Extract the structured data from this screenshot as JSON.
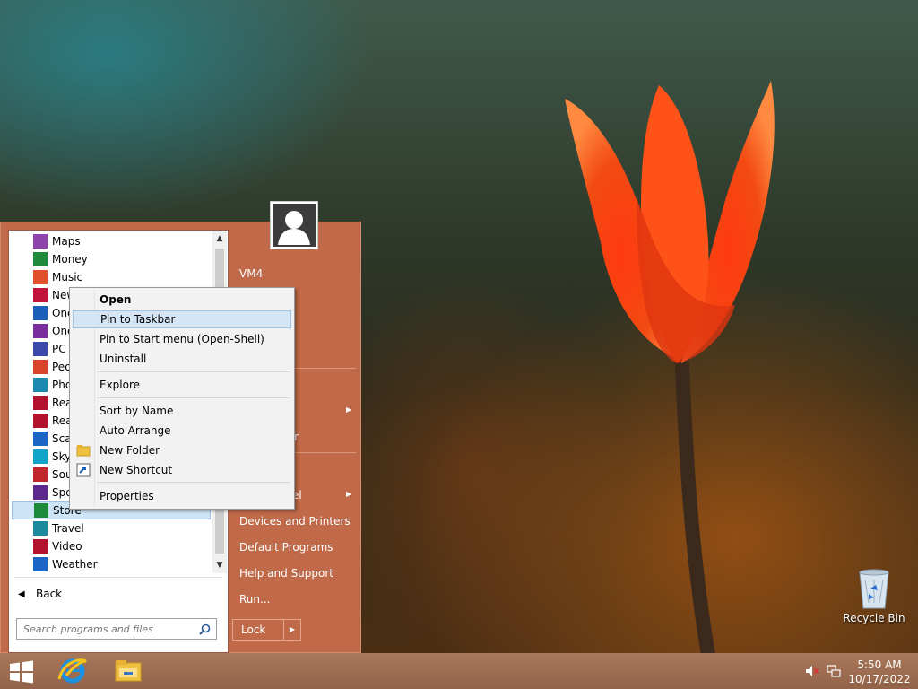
{
  "programs": [
    {
      "label": "Maps",
      "icon": "maps-icon",
      "color": "#8e44ad"
    },
    {
      "label": "Money",
      "icon": "money-icon",
      "color": "#1f8a3b"
    },
    {
      "label": "Music",
      "icon": "music-icon",
      "color": "#e0502a"
    },
    {
      "label": "New",
      "icon": "news-icon",
      "color": "#c0143c"
    },
    {
      "label": "One",
      "icon": "onedrive-icon",
      "color": "#1b5fb8"
    },
    {
      "label": "One",
      "icon": "onenote-icon",
      "color": "#7a2d9c"
    },
    {
      "label": "PC",
      "icon": "pc-settings-icon",
      "color": "#3b4aa8"
    },
    {
      "label": "Peo",
      "icon": "people-icon",
      "color": "#d8452b"
    },
    {
      "label": "Pho",
      "icon": "photos-icon",
      "color": "#1a8ab0"
    },
    {
      "label": "Rea",
      "icon": "reader-icon",
      "color": "#b3122f"
    },
    {
      "label": "Rea",
      "icon": "reading-list-icon",
      "color": "#b3122f"
    },
    {
      "label": "Sca",
      "icon": "scan-icon",
      "color": "#1b66c4"
    },
    {
      "label": "Sky",
      "icon": "skype-icon",
      "color": "#12a3c8"
    },
    {
      "label": "Sou",
      "icon": "sound-recorder-icon",
      "color": "#c0282c"
    },
    {
      "label": "Spo",
      "icon": "sports-icon",
      "color": "#5b2a8c"
    },
    {
      "label": "Store",
      "icon": "store-icon",
      "color": "#1d8a3b",
      "selected": true
    },
    {
      "label": "Travel",
      "icon": "travel-icon",
      "color": "#1a8a9c"
    },
    {
      "label": "Video",
      "icon": "video-icon",
      "color": "#b3122f"
    },
    {
      "label": "Weather",
      "icon": "weather-icon",
      "color": "#1b66c4"
    }
  ],
  "back_label": "Back",
  "search": {
    "placeholder": "Search programs and files"
  },
  "right_panel": {
    "user": "VM4",
    "items": [
      {
        "label": "s",
        "has_submenu": true
      },
      {
        "label": "ter",
        "has_submenu": false
      },
      {
        "label": "el",
        "has_submenu": true
      },
      {
        "label": "Devices and Printers"
      },
      {
        "label": "Default Programs"
      },
      {
        "label": "Help and Support"
      },
      {
        "label": "Run..."
      }
    ],
    "lock_label": "Lock"
  },
  "context_menu": {
    "items": [
      {
        "label": "Open",
        "bold": true
      },
      {
        "label": "Pin to Taskbar",
        "hover": true
      },
      {
        "label": "Pin to Start menu (Open-Shell)"
      },
      {
        "label": "Uninstall"
      },
      {
        "label": "Explore"
      },
      {
        "label": "Sort by Name"
      },
      {
        "label": "Auto Arrange"
      },
      {
        "label": "New Folder",
        "icon": "folder-icon"
      },
      {
        "label": "New Shortcut",
        "icon": "shortcut-icon"
      },
      {
        "label": "Properties"
      }
    ]
  },
  "desktop": {
    "recycle_bin_label": "Recycle Bin"
  },
  "taskbar": {
    "time": "5:50 AM",
    "date": "10/17/2022"
  },
  "colors": {
    "start_menu": "#c06a4a",
    "taskbar": "#9c6a4e",
    "selection": "#cde4f7"
  }
}
